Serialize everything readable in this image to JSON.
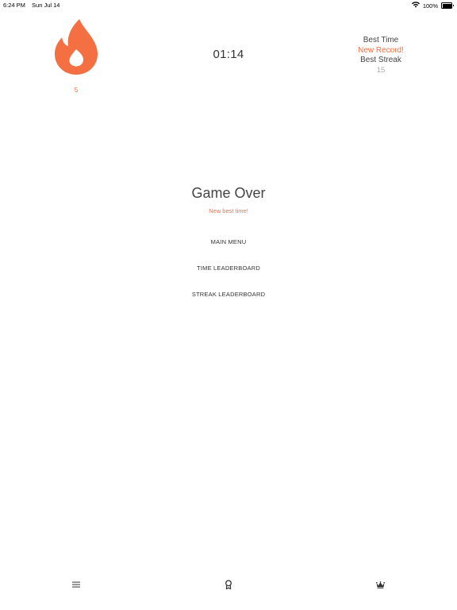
{
  "status_bar": {
    "time": "6:24 PM",
    "date": "Sun Jul 14",
    "battery": "100%"
  },
  "streak": {
    "count": "5",
    "icon": "flame-icon",
    "color": "#f47042"
  },
  "timer": {
    "value": "01:14"
  },
  "stats": {
    "best_time_label": "Best Time",
    "best_time_value": "New Record!",
    "best_streak_label": "Best Streak",
    "best_streak_value": "15"
  },
  "game_over": {
    "title": "Game Over",
    "subtitle": "New best time!"
  },
  "menu": {
    "main_menu": "MAIN MENU",
    "time_leaderboard": "TIME LEADERBOARD",
    "streak_leaderboard": "STREAK LEADERBOARD"
  },
  "tab_bar": {
    "icons": [
      "menu-icon",
      "award-icon",
      "crown-icon"
    ]
  },
  "colors": {
    "accent": "#f47042",
    "text": "#444444",
    "muted": "#aaaaaa"
  }
}
